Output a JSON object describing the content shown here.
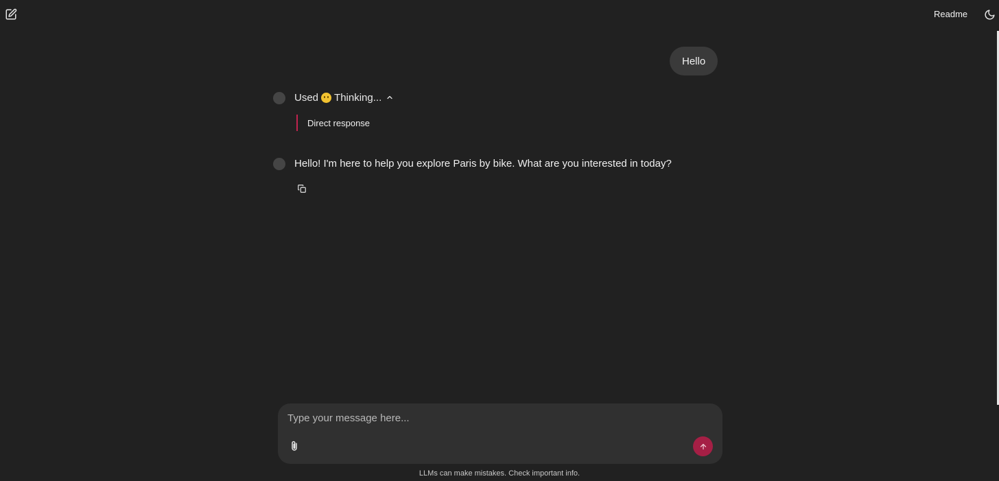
{
  "header": {
    "readme_label": "Readme",
    "new_chat_icon": "edit-square-icon",
    "theme_icon": "moon-icon"
  },
  "messages": {
    "user": {
      "text": "Hello"
    },
    "tool": {
      "used_label": "Used",
      "emoji_icon": "thinking-face-emoji",
      "tool_name": "Thinking...",
      "expanded": true,
      "detail": "Direct response"
    },
    "assistant": {
      "text": "Hello! I'm here to help you explore Paris by bike. What are you interested in today?"
    }
  },
  "composer": {
    "placeholder": "Type your message here...",
    "value": "",
    "send_color": "#a51f45"
  },
  "footer": {
    "disclaimer": "LLMs can make mistakes. Check important info."
  },
  "colors": {
    "background": "#212121",
    "accent": "#c2244f"
  }
}
